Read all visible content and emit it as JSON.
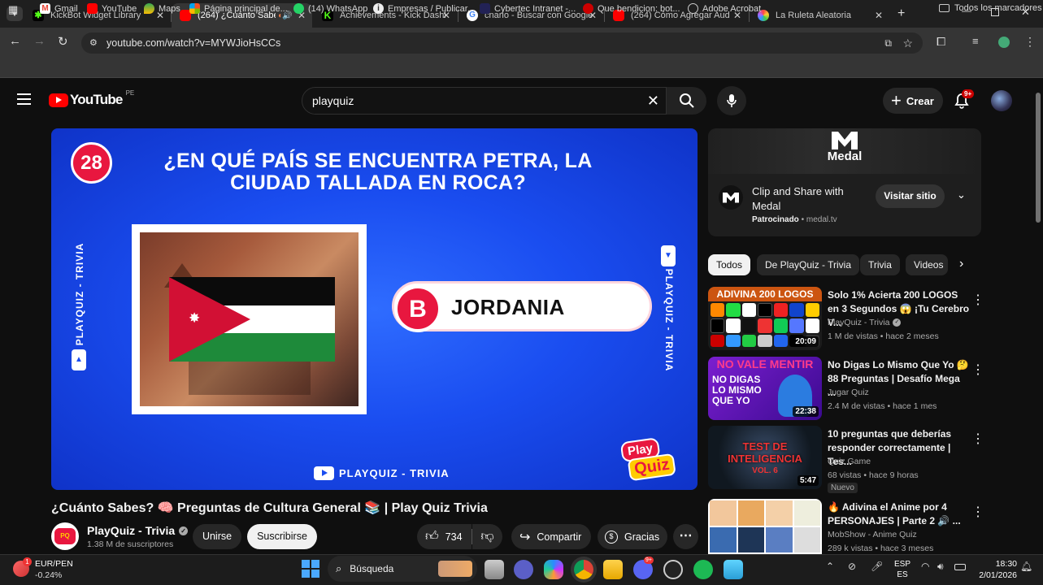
{
  "browser": {
    "tabs": [
      {
        "title": "KickBot Widget Library",
        "icon_color": "#53fc18"
      },
      {
        "title": "(264) ¿Cuánto Sabes? ",
        "icon_color": "#ff0000"
      },
      {
        "title": "Achievements - Kick Dashb",
        "icon_color": "#53fc18"
      },
      {
        "title": "cnario - Buscar con Google",
        "icon_color": "#ffffff"
      },
      {
        "title": "(264) Cómo Agregar Audio",
        "icon_color": "#ff0000"
      },
      {
        "title": "La Ruleta Aleatoria",
        "icon_color": "#8a6cff"
      }
    ],
    "url": "youtube.com/watch?v=MYWJioHsCCs",
    "bookmarks": [
      "Gmail",
      "YouTube",
      "Maps",
      "Página principal de...",
      "(14) WhatsApp",
      "Empresas / Publicar...",
      "Cybertec Intranet -...",
      "Que bendicion: bot...",
      "Adobe Acrobat"
    ],
    "all_bookmarks": "Todos los marcadores"
  },
  "yt": {
    "logo": "YouTube",
    "country": "PE",
    "search_value": "playquiz",
    "create_label": "Crear",
    "notif_badge": "9+"
  },
  "video": {
    "number": "28",
    "question": "¿EN QUÉ PAÍS SE ENCUENTRA PETRA, LA CIUDAD TALLADA EN ROCA?",
    "answer_letter": "B",
    "answer_text": "JORDANIA",
    "side_label": "PLAYQUIZ - TRIVIA",
    "bottom_label": "PLAYQUIZ - TRIVIA",
    "brand_top": "Play",
    "brand_bottom": "Quiz",
    "title": "¿Cuánto Sabes? 🧠 Preguntas de Cultura General 📚 | Play Quiz Trivia",
    "channel": "PlayQuiz - Trivia",
    "subscribers": "1.38 M de suscriptores",
    "join_label": "Unirse",
    "subscribe_label": "Suscribirse",
    "likes": "734",
    "share_label": "Compartir",
    "thanks_label": "Gracias"
  },
  "ad": {
    "brand": "Medal",
    "headline": "Clip and Share with Medal",
    "sponsored": "Patrocinado",
    "domain": "medal.tv",
    "cta": "Visitar sitio"
  },
  "chips": [
    "Todos",
    "De PlayQuiz - Trivia",
    "Trivia",
    "Videos"
  ],
  "related": [
    {
      "title": "Solo 1% Acierta 200 LOGOS en 3 Segundos 😱 ¡Tu Cerebro V...",
      "channel": "PlayQuiz - Trivia",
      "stats": "1 M de vistas • hace 2 meses",
      "duration": "20:09",
      "thumb_text": "ADIVINA 200 LOGOS",
      "badge": ""
    },
    {
      "title": "No Digas Lo Mismo Que Yo 🤔 88 Preguntas | Desafío Mega ...",
      "channel": "Jugar Quiz",
      "stats": "2.4 M de vistas • hace 1 mes",
      "duration": "22:38",
      "thumb_text": "NO VALE MENTIR",
      "thumb_text2": "NO DIGAS LO MISMO QUE YO",
      "badge": ""
    },
    {
      "title": "10 preguntas que deberías responder correctamente | Tes...",
      "channel": "Quiz Game",
      "stats": "68 vistas • hace 9 horas",
      "duration": "5:47",
      "thumb_text": "TEST DE INTELIGENCIA",
      "thumb_text2": "VOL. 6",
      "badge": "Nuevo"
    },
    {
      "title": "🔥 Adivina el Anime por 4 PERSONAJES | Parte 2 🔊 ...",
      "channel": "MobShow - Anime Quiz",
      "stats": "289 k vistas • hace 3 meses",
      "duration": "",
      "thumb_text": "",
      "badge": ""
    }
  ],
  "taskbar": {
    "stock_name": "EUR/PEN",
    "stock_change": "-0.24%",
    "stock_badge": "1",
    "search_label": "Búsqueda",
    "lang1": "ESP",
    "lang2": "ES",
    "time": "18:30",
    "date": "2/01/2026",
    "discord_badge": "9+"
  }
}
